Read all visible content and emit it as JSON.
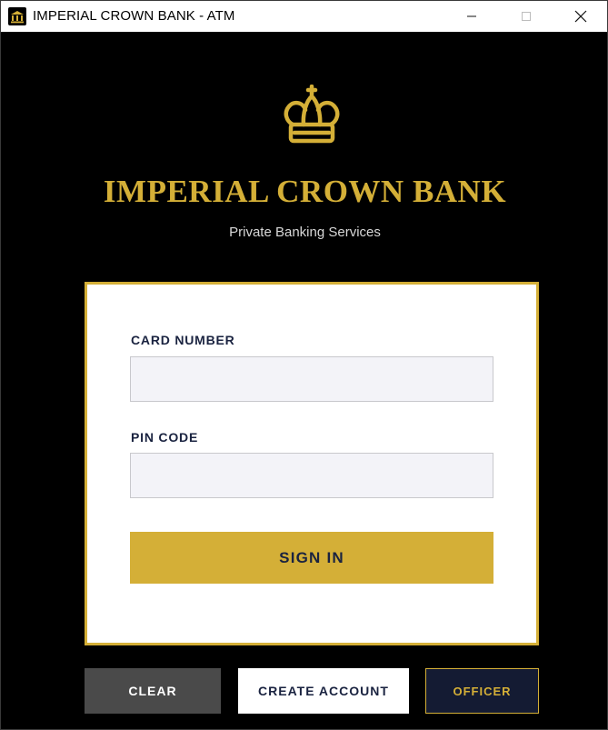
{
  "window": {
    "title": "IMPERIAL CROWN BANK - ATM",
    "app_icon": "bank-icon",
    "controls": [
      "minimize-icon",
      "maximize-icon",
      "close-icon"
    ]
  },
  "brand": {
    "logo_icon": "crown-icon",
    "name": "IMPERIAL CROWN BANK",
    "tagline": "Private Banking Services"
  },
  "login": {
    "card_number_label": "CARD NUMBER",
    "card_number_value": "",
    "pin_label": "PIN CODE",
    "pin_value": "",
    "sign_in_label": "SIGN IN"
  },
  "actions": {
    "clear_label": "CLEAR",
    "create_account_label": "CREATE ACCOUNT",
    "officer_label": "OFFICER"
  },
  "colors": {
    "gold": "#d4af37",
    "background": "#000000",
    "navy": "#1a2340",
    "clear_button": "#4a4a4a",
    "officer_button": "#141b33"
  }
}
